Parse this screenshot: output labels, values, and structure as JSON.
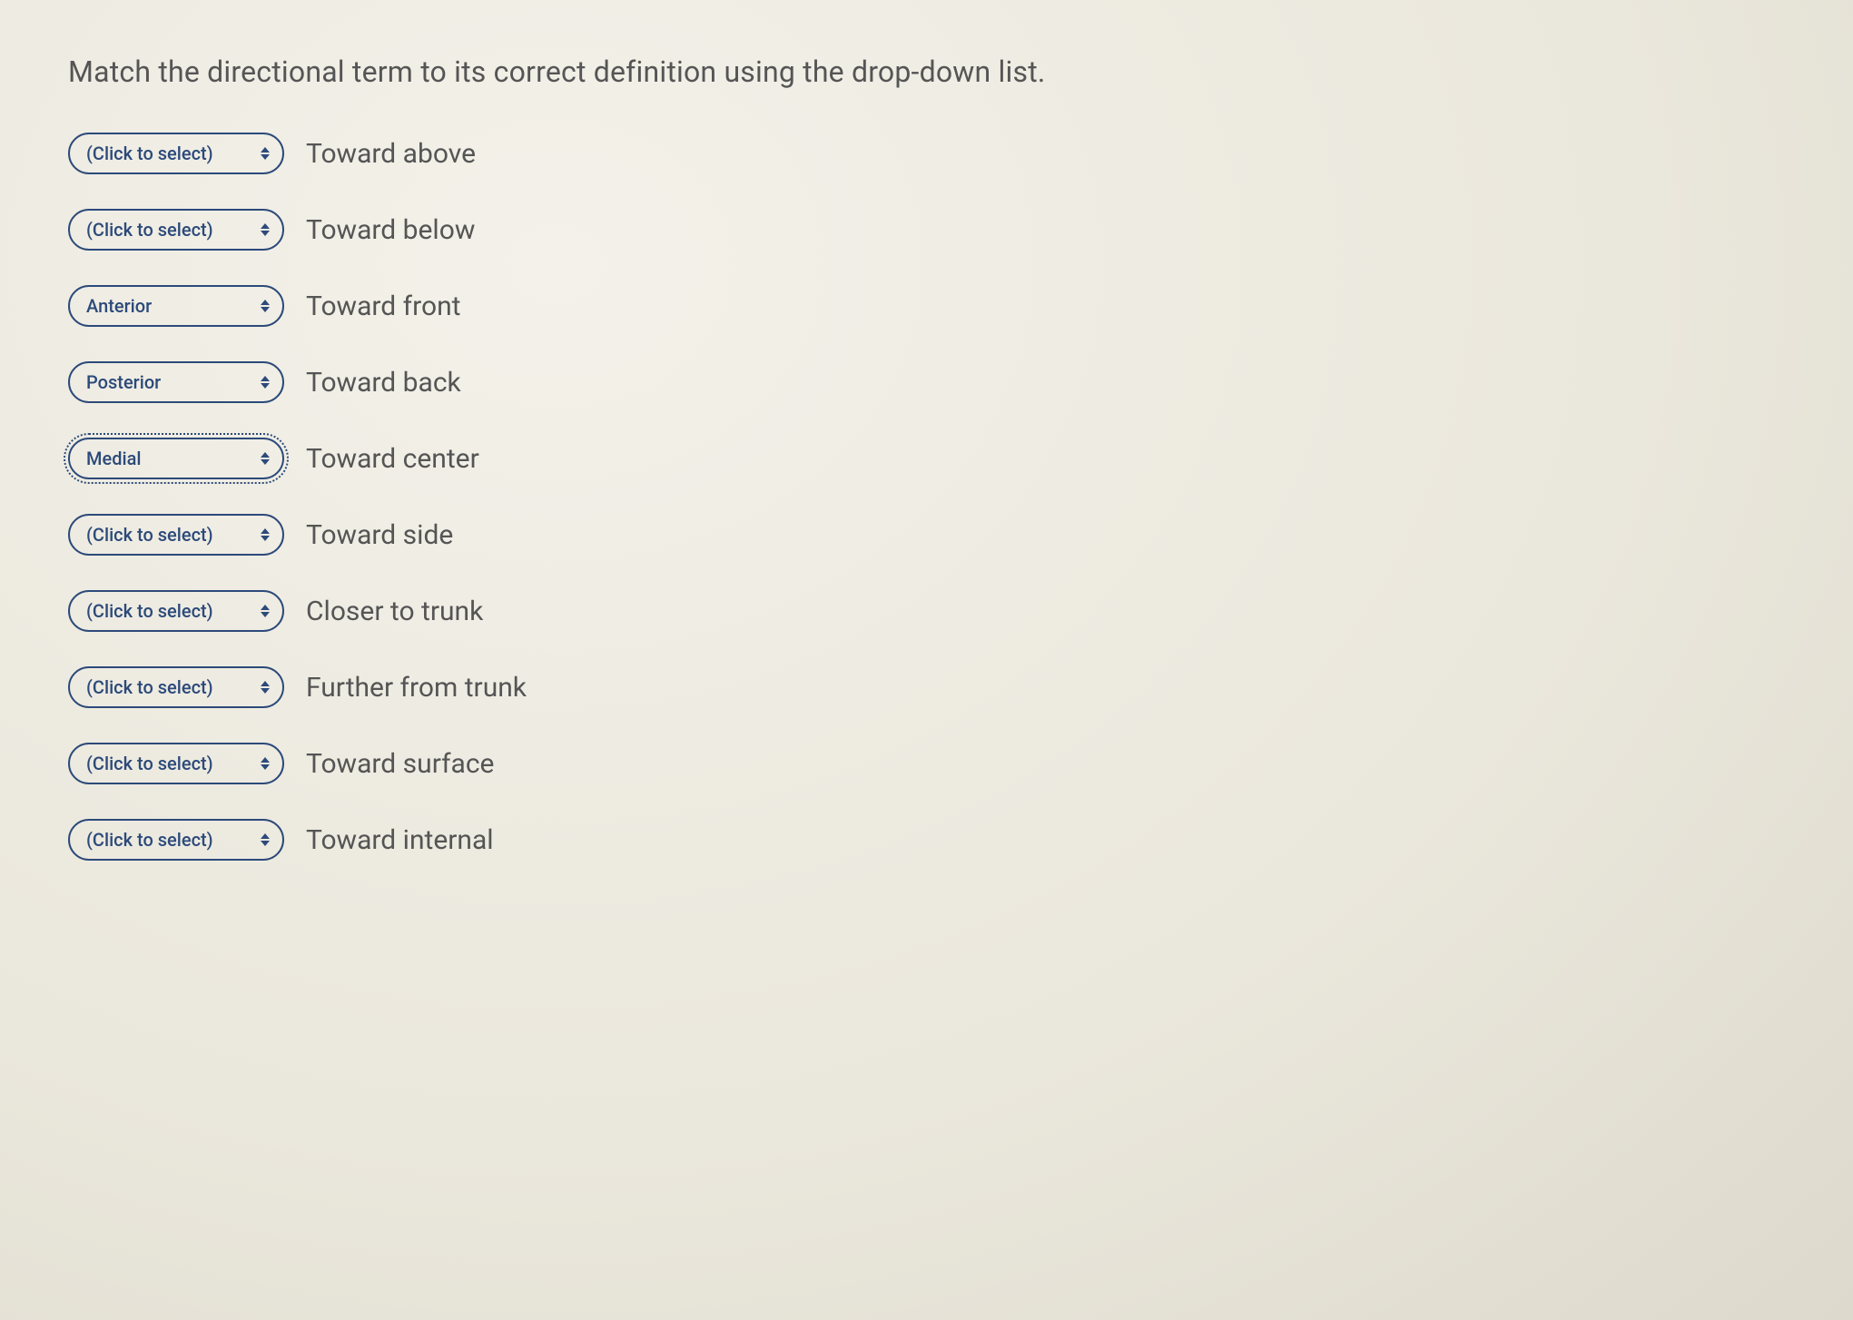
{
  "prompt": "Match the directional term to its correct definition using the drop-down list.",
  "placeholder": "(Click to select)",
  "rows": [
    {
      "selected": "",
      "definition": "Toward above"
    },
    {
      "selected": "",
      "definition": "Toward below"
    },
    {
      "selected": "Anterior",
      "definition": "Toward front"
    },
    {
      "selected": "Posterior",
      "definition": "Toward back"
    },
    {
      "selected": "Medial",
      "definition": "Toward center",
      "focused": true
    },
    {
      "selected": "",
      "definition": "Toward side"
    },
    {
      "selected": "",
      "definition": "Closer to trunk"
    },
    {
      "selected": "",
      "definition": "Further from trunk"
    },
    {
      "selected": "",
      "definition": "Toward surface"
    },
    {
      "selected": "",
      "definition": "Toward internal"
    }
  ]
}
